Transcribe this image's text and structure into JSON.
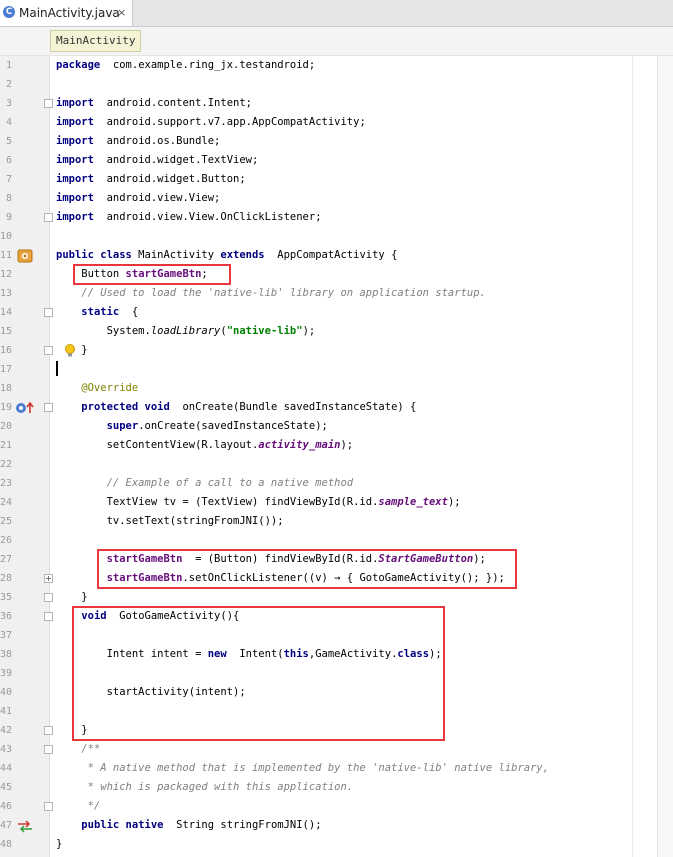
{
  "tab": {
    "icon": "C",
    "label": "MainActivity.java",
    "close": "×"
  },
  "breadcrumb": "MainActivity",
  "lines": [
    {
      "n": "1",
      "t": [
        [
          "kw",
          "package"
        ],
        [
          "",
          "  com.example.ring_jx.testandroid;"
        ]
      ]
    },
    {
      "n": "2",
      "t": []
    },
    {
      "n": "3",
      "t": [
        [
          "kw",
          "import"
        ],
        [
          "",
          "  android.content.Intent;"
        ]
      ]
    },
    {
      "n": "4",
      "t": [
        [
          "kw",
          "import"
        ],
        [
          "",
          "  android.support.v7.app.AppCompatActivity;"
        ]
      ]
    },
    {
      "n": "5",
      "t": [
        [
          "kw",
          "import"
        ],
        [
          "",
          "  android.os.Bundle;"
        ]
      ]
    },
    {
      "n": "6",
      "t": [
        [
          "kw",
          "import"
        ],
        [
          "",
          "  android.widget.TextView;"
        ]
      ]
    },
    {
      "n": "7",
      "t": [
        [
          "kw",
          "import"
        ],
        [
          "",
          "  android.widget.Button;"
        ]
      ]
    },
    {
      "n": "8",
      "t": [
        [
          "kw",
          "import"
        ],
        [
          "",
          "  android.view.View;"
        ]
      ]
    },
    {
      "n": "9",
      "t": [
        [
          "kw",
          "import"
        ],
        [
          "",
          "  android.view.View.OnClickListener;"
        ]
      ]
    },
    {
      "n": "10",
      "t": []
    },
    {
      "n": "11",
      "t": [
        [
          "kw",
          "public class"
        ],
        [
          "",
          " MainActivity "
        ],
        [
          "kw",
          "extends"
        ],
        [
          "",
          "  AppCompatActivity {"
        ]
      ]
    },
    {
      "n": "12",
      "t": [
        [
          "",
          "    Button "
        ],
        [
          "field",
          "startGameBtn"
        ],
        [
          "",
          ";"
        ]
      ]
    },
    {
      "n": "13",
      "t": [
        [
          "comment",
          "    // Used to load the 'native-lib' library on application startup."
        ]
      ]
    },
    {
      "n": "14",
      "t": [
        [
          "",
          "    "
        ],
        [
          "kw",
          "static"
        ],
        [
          "",
          "  {"
        ]
      ]
    },
    {
      "n": "15",
      "t": [
        [
          "",
          "        System."
        ],
        [
          "static",
          "loadLibrary"
        ],
        [
          "",
          "("
        ],
        [
          "string",
          "\"native-lib\""
        ],
        [
          "",
          ");"
        ]
      ]
    },
    {
      "n": "16",
      "t": [
        [
          "",
          "    }"
        ]
      ]
    },
    {
      "n": "17",
      "t": []
    },
    {
      "n": "18",
      "t": [
        [
          "annot",
          "    @Override"
        ]
      ]
    },
    {
      "n": "19",
      "t": [
        [
          "",
          "    "
        ],
        [
          "kw",
          "protected void"
        ],
        [
          "",
          "  onCreate(Bundle savedInstanceState) {"
        ]
      ]
    },
    {
      "n": "20",
      "t": [
        [
          "",
          "        "
        ],
        [
          "kw",
          "super"
        ],
        [
          "",
          ".onCreate(savedInstanceState);"
        ]
      ]
    },
    {
      "n": "21",
      "t": [
        [
          "",
          "        setContentView(R.layout."
        ],
        [
          "italic",
          "activity_main"
        ],
        [
          "",
          ");"
        ]
      ]
    },
    {
      "n": "22",
      "t": []
    },
    {
      "n": "23",
      "t": [
        [
          "comment",
          "        // Example of a call to a native method"
        ]
      ]
    },
    {
      "n": "24",
      "t": [
        [
          "",
          "        TextView tv = (TextView) findViewById(R.id."
        ],
        [
          "italic",
          "sample_text"
        ],
        [
          "",
          ");"
        ]
      ]
    },
    {
      "n": "25",
      "t": [
        [
          "",
          "        tv.setText(stringFromJNI());"
        ]
      ]
    },
    {
      "n": "26",
      "t": []
    },
    {
      "n": "27",
      "t": [
        [
          "",
          "        "
        ],
        [
          "field",
          "startGameBtn"
        ],
        [
          "",
          "  = (Button) findViewById(R.id."
        ],
        [
          "italic",
          "StartGameButton"
        ],
        [
          "",
          ");"
        ]
      ]
    },
    {
      "n": "28",
      "t": [
        [
          "",
          "        "
        ],
        [
          "field",
          "startGameBtn"
        ],
        [
          "",
          ".setOnClickListener((v) → { GotoGameActivity(); });"
        ]
      ]
    },
    {
      "n": "35",
      "t": [
        [
          "",
          "    }"
        ]
      ]
    },
    {
      "n": "36",
      "t": [
        [
          "",
          "    "
        ],
        [
          "kw",
          "void"
        ],
        [
          "",
          "  GotoGameActivity(){"
        ]
      ]
    },
    {
      "n": "37",
      "t": []
    },
    {
      "n": "38",
      "t": [
        [
          "",
          "        Intent intent = "
        ],
        [
          "kw",
          "new"
        ],
        [
          "",
          "  Intent("
        ],
        [
          "kw",
          "this"
        ],
        [
          "",
          ",GameActivity."
        ],
        [
          "kw",
          "class"
        ],
        [
          "",
          ");"
        ]
      ]
    },
    {
      "n": "39",
      "t": []
    },
    {
      "n": "40",
      "t": [
        [
          "",
          "        startActivity(intent);"
        ]
      ]
    },
    {
      "n": "41",
      "t": []
    },
    {
      "n": "42",
      "t": [
        [
          "",
          "    }"
        ]
      ]
    },
    {
      "n": "43",
      "t": [
        [
          "comment",
          "    /**"
        ]
      ]
    },
    {
      "n": "44",
      "t": [
        [
          "comment",
          "     * A native method that is implemented by the 'native-lib' native library,"
        ]
      ]
    },
    {
      "n": "45",
      "t": [
        [
          "comment",
          "     * which is packaged with this application."
        ]
      ]
    },
    {
      "n": "46",
      "t": [
        [
          "comment",
          "     */"
        ]
      ]
    },
    {
      "n": "47",
      "t": [
        [
          "",
          "    "
        ],
        [
          "kw",
          "public native"
        ],
        [
          "",
          "  String stringFromJNI();"
        ]
      ]
    },
    {
      "n": "48",
      "t": [
        [
          "",
          "}"
        ]
      ]
    }
  ],
  "gutter_icons": [
    {
      "line": "11",
      "name": "android-activity-icon"
    },
    {
      "line": "16",
      "name": "lightbulb-icon"
    },
    {
      "line": "19",
      "name": "override-method-icon"
    },
    {
      "line": "47",
      "name": "native-method-icon"
    }
  ],
  "folds": [
    {
      "line": "3",
      "kind": "minus"
    },
    {
      "line": "9",
      "kind": "minus"
    },
    {
      "line": "14",
      "kind": "minus"
    },
    {
      "line": "16",
      "kind": "minus"
    },
    {
      "line": "19",
      "kind": "minus"
    },
    {
      "line": "28",
      "kind": "plus"
    },
    {
      "line": "35",
      "kind": "minus"
    },
    {
      "line": "36",
      "kind": "minus"
    },
    {
      "line": "42",
      "kind": "minus"
    },
    {
      "line": "43",
      "kind": "minus"
    },
    {
      "line": "46",
      "kind": "minus"
    }
  ],
  "highlights": [
    {
      "from_line": "12",
      "to_line": "12",
      "label": "field-declaration-highlight"
    },
    {
      "from_line": "27",
      "to_line": "28",
      "label": "listener-setup-highlight"
    },
    {
      "from_line": "36",
      "to_line": "42",
      "label": "goto-method-highlight"
    }
  ],
  "colors": {
    "keyword": "#000080",
    "field": "#660e7a",
    "comment": "#808080",
    "string": "#008000",
    "annotation": "#808000",
    "highlight": "#e8373a"
  }
}
